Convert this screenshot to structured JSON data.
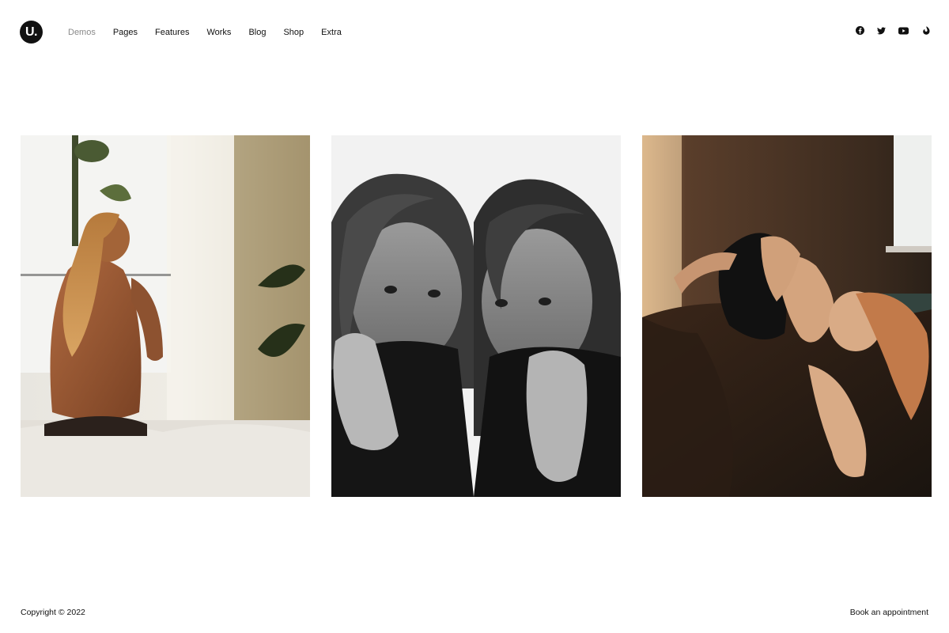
{
  "header": {
    "logo_text": "U.",
    "nav": [
      {
        "label": "Demos",
        "active": true
      },
      {
        "label": "Pages"
      },
      {
        "label": "Features"
      },
      {
        "label": "Works"
      },
      {
        "label": "Blog"
      },
      {
        "label": "Shop"
      },
      {
        "label": "Extra"
      }
    ],
    "social_icons": [
      "facebook-icon",
      "twitter-icon",
      "youtube-icon",
      "vimeo-icon"
    ]
  },
  "gallery": {
    "photos": [
      {
        "name": "woman-by-window-photo"
      },
      {
        "name": "two-women-turtleneck-photo"
      },
      {
        "name": "woman-reclining-sofa-photo"
      }
    ]
  },
  "footer": {
    "copyright": "Copyright © 2022",
    "cta": "Book an appointment"
  },
  "colors": {
    "text": "#111111",
    "nav_active": "#8a8a8a",
    "background": "#ffffff"
  }
}
